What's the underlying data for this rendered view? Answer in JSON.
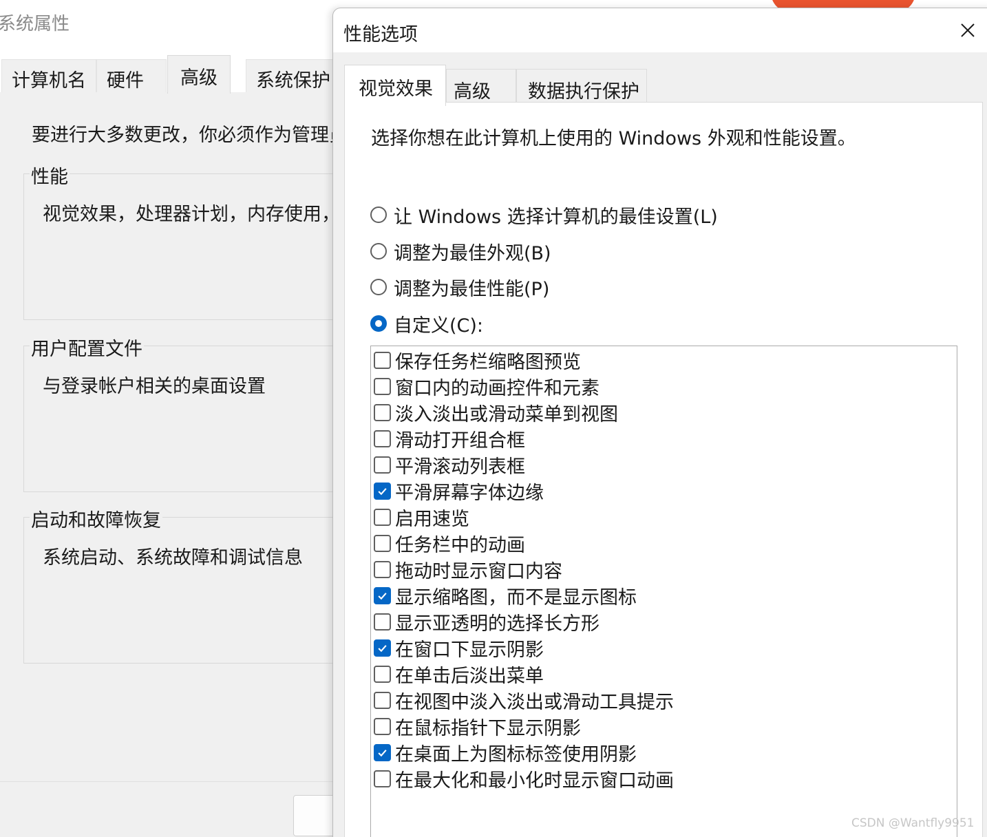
{
  "background_window": {
    "title": "系统属性",
    "tabs": [
      "计算机名",
      "硬件",
      "高级",
      "系统保护"
    ],
    "active_tab": "高级",
    "admin_note": "要进行大多数更改，你必须作为管理员",
    "groups": [
      {
        "legend": "性能",
        "description": "视觉效果，处理器计划，内存使用，"
      },
      {
        "legend": "用户配置文件",
        "description": "与登录帐户相关的桌面设置"
      },
      {
        "legend": "启动和故障恢复",
        "description": "系统启动、系统故障和调试信息"
      }
    ]
  },
  "dialog": {
    "title": "性能选项",
    "close_icon": "close-icon",
    "tabs": [
      "视觉效果",
      "高级",
      "数据执行保护"
    ],
    "active_tab": "视觉效果",
    "intro": "选择你想在此计算机上使用的 Windows 外观和性能设置。",
    "radios": [
      {
        "label": "让 Windows 选择计算机的最佳设置(L)",
        "checked": false
      },
      {
        "label": "调整为最佳外观(B)",
        "checked": false
      },
      {
        "label": "调整为最佳性能(P)",
        "checked": false
      },
      {
        "label": "自定义(C):",
        "checked": true
      }
    ],
    "effects": [
      {
        "label": "保存任务栏缩略图预览",
        "checked": false
      },
      {
        "label": "窗口内的动画控件和元素",
        "checked": false
      },
      {
        "label": "淡入淡出或滑动菜单到视图",
        "checked": false
      },
      {
        "label": "滑动打开组合框",
        "checked": false
      },
      {
        "label": "平滑滚动列表框",
        "checked": false
      },
      {
        "label": "平滑屏幕字体边缘",
        "checked": true
      },
      {
        "label": "启用速览",
        "checked": false
      },
      {
        "label": "任务栏中的动画",
        "checked": false
      },
      {
        "label": "拖动时显示窗口内容",
        "checked": false
      },
      {
        "label": "显示缩略图，而不是显示图标",
        "checked": true
      },
      {
        "label": "显示亚透明的选择长方形",
        "checked": false
      },
      {
        "label": "在窗口下显示阴影",
        "checked": true
      },
      {
        "label": "在单击后淡出菜单",
        "checked": false
      },
      {
        "label": "在视图中淡入淡出或滑动工具提示",
        "checked": false
      },
      {
        "label": "在鼠标指针下显示阴影",
        "checked": false
      },
      {
        "label": "在桌面上为图标标签使用阴影",
        "checked": true
      },
      {
        "label": "在最大化和最小化时显示窗口动画",
        "checked": false
      }
    ]
  },
  "colors": {
    "accent": "#0567c6",
    "window_bg": "#f0f0f0",
    "orange": "#e9542f"
  },
  "watermark": "CSDN @Wantfly9951"
}
